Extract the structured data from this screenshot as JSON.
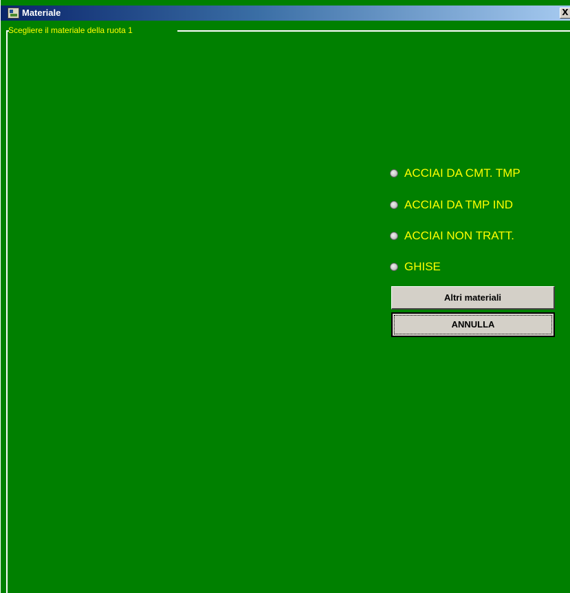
{
  "window": {
    "title": "Materiale",
    "close_glyph": "X",
    "background_color": "#008000"
  },
  "groupbox": {
    "label": "Scegliere il materiale della ruota 1",
    "label_color": "#ffff00"
  },
  "material_options": [
    {
      "label": "ACCIAI DA CMT. TMP",
      "selected": false
    },
    {
      "label": "ACCIAI DA TMP IND",
      "selected": false
    },
    {
      "label": "ACCIAI NON TRATT.",
      "selected": false
    },
    {
      "label": "GHISE",
      "selected": false
    }
  ],
  "buttons": {
    "other_materials": "Altri materiali",
    "cancel": "ANNULLA"
  },
  "icons": {
    "app": "app-icon",
    "close": "close-icon",
    "radio": "radio-icon"
  }
}
